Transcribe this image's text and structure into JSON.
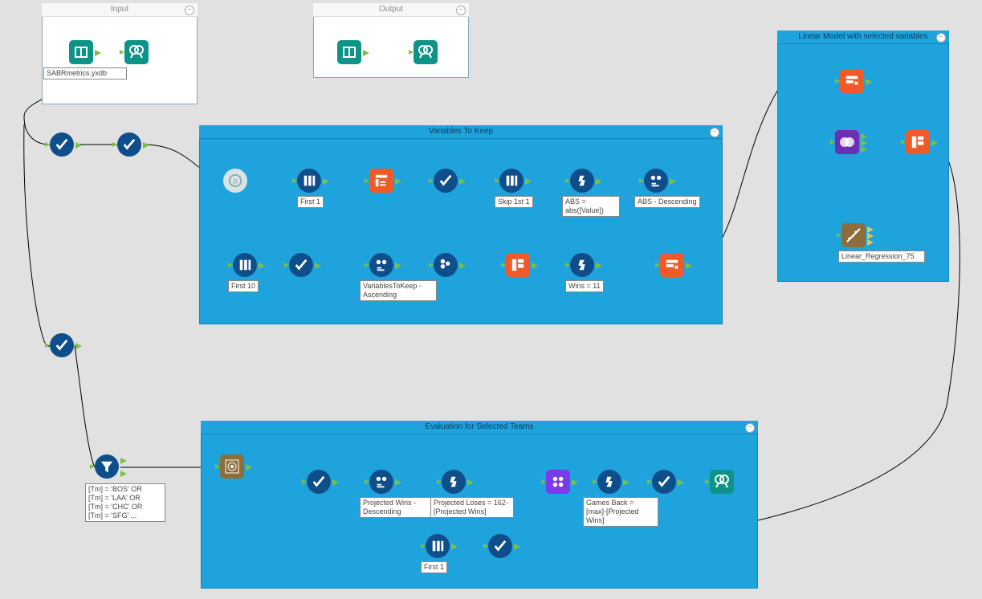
{
  "containers": {
    "input": {
      "title": "Input"
    },
    "output": {
      "title": "Output"
    },
    "vars": {
      "title": "Variables To Keep"
    },
    "linear": {
      "title": "Linear Model with selected variables"
    },
    "eval": {
      "title": "Evaluation for Selected Teams"
    }
  },
  "labels": {
    "inputFile": "SABRmetrics.yxdb",
    "first1_a": "First 1",
    "skip1st1": "Skip 1st 1",
    "abs_formula": "ABS = abs([Value])",
    "abs_desc": "ABS - Descending",
    "first10": "First 10",
    "vars_asc": "VariablesToKeep - Ascending",
    "wins11": "Wins = 11",
    "linreg": "Linear_Regression_75",
    "filter_expr": "[Tm] = 'BOS' OR\n[Tm] = 'LAA' OR\n[Tm] = 'CHC' OR\n[Tm] = 'SFG' ...",
    "projwins": "Projected Wins - Descending",
    "projloses": "Projected Loses = 162-[Projected Wins]",
    "gamesback": "Games Back = [max]-[Projected Wins]",
    "first1_b": "First 1"
  },
  "icons": {
    "macro_input": "macro-input-icon",
    "macro_output": "macro-output-icon",
    "browse": "browse-icon",
    "select": "select-icon",
    "sample": "sample-icon",
    "transpose": "transpose-icon",
    "sort": "sort-icon",
    "formula": "formula-icon",
    "recordid": "recordid-icon",
    "dyn_select": "dynamic-select-icon",
    "dyn_select2": "dynamic-rename-icon",
    "filter": "filter-icon",
    "crosstab": "crosstab-icon",
    "linear_reg": "linear-regression-icon",
    "score": "score-icon",
    "summarize": "summarize-icon",
    "join": "join-icon",
    "append": "append-icon",
    "find_nearest": "find-replace-icon"
  },
  "colors": {
    "canvas": "#e1e1e1",
    "container_blue": "#1fa3dd",
    "tool_blue": "#0e4f8b",
    "tool_green": "#0d9488",
    "tool_orange": "#ef5a28",
    "tool_purple": "#6b2fb3",
    "tool_tan": "#8d6e3a"
  }
}
